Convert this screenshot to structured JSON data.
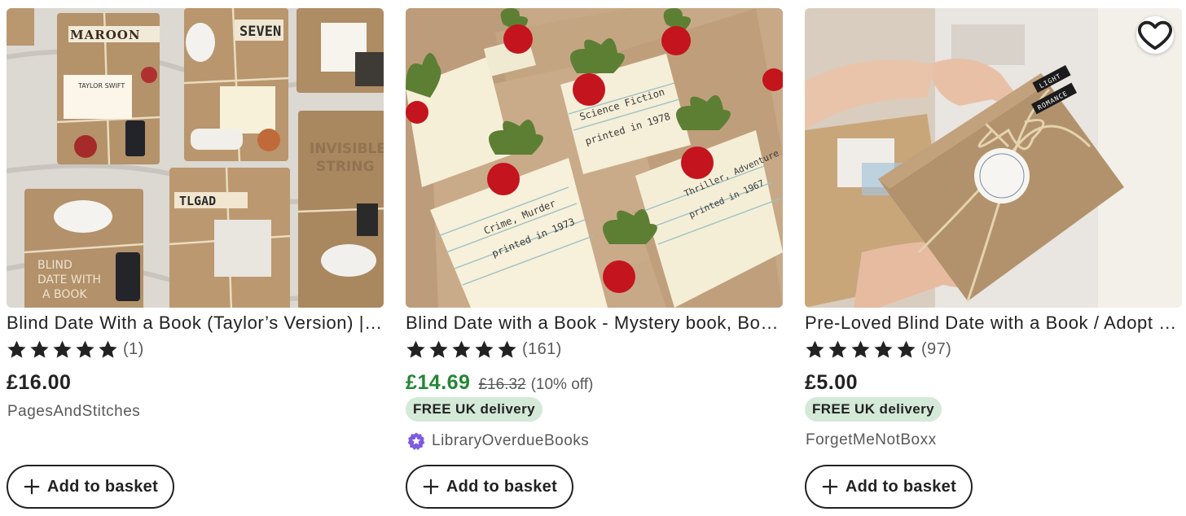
{
  "colors": {
    "sale_price": "#258635",
    "delivery_badge_bg": "#d4e9d7",
    "star_seller_badge": "#7f5ae0",
    "text": "#222222",
    "muted": "#595959"
  },
  "listings": [
    {
      "title": "Blind Date With a Book (Taylor’s Version) | Taylor Swift",
      "rating_stars": 5,
      "reviews": "(1)",
      "price": "£16.00",
      "shop": "PagesAndStitches",
      "add_label": "Add to basket",
      "image_labels": [
        "MAROON",
        "SEVEN",
        "INVISIBLE STRING",
        "TLGAD",
        "BLIND DATE WITH A BOOK",
        "TAYLOR SWIFT"
      ]
    },
    {
      "title": "Blind Date with a Book - Mystery book, Book lover gift",
      "rating_stars": 5,
      "reviews": "(161)",
      "price": "£14.69",
      "original_price": "£16.32",
      "discount": "(10% off)",
      "delivery": "FREE UK delivery",
      "shop": "LibraryOverdueBooks",
      "star_seller": true,
      "add_label": "Add to basket",
      "image_labels": [
        "Science Fiction",
        "printed in 1978",
        "Crime, Murder",
        "printed in 1973",
        "Thriller, Adventure",
        "printed in 1967"
      ]
    },
    {
      "title": "Pre-Loved Blind Date with a Book / Adopt a Book",
      "rating_stars": 5,
      "reviews": "(97)",
      "price": "£5.00",
      "delivery": "FREE UK delivery",
      "shop": "ForgetMeNotBoxx",
      "add_label": "Add to basket",
      "image_labels": [
        "LIGHT",
        "ROMANCE"
      ]
    }
  ]
}
